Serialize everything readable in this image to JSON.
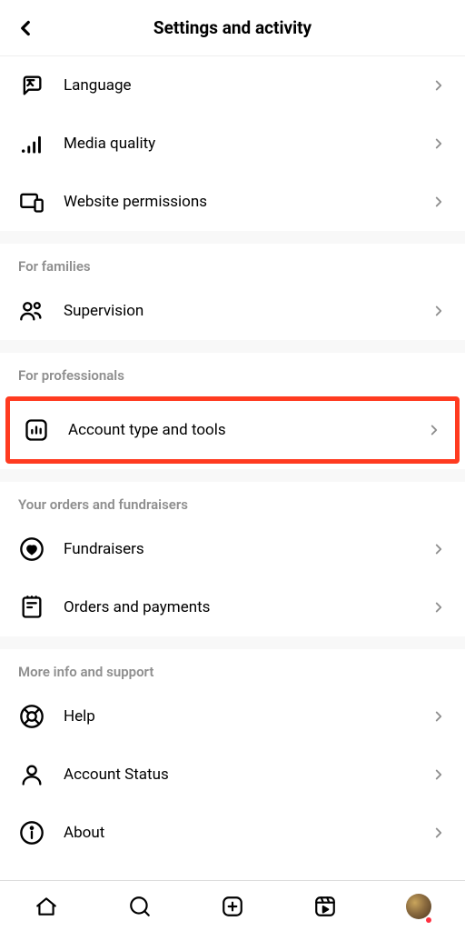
{
  "header": {
    "title": "Settings and activity"
  },
  "rows": {
    "language": "Language",
    "media_quality": "Media quality",
    "website_permissions": "Website permissions",
    "supervision": "Supervision",
    "account_type_tools": "Account type and tools",
    "fundraisers": "Fundraisers",
    "orders_payments": "Orders and payments",
    "help": "Help",
    "account_status": "Account Status",
    "about": "About"
  },
  "sections": {
    "families": "For families",
    "professionals": "For professionals",
    "orders_fundraisers": "Your orders and fundraisers",
    "more_info": "More info and support"
  }
}
